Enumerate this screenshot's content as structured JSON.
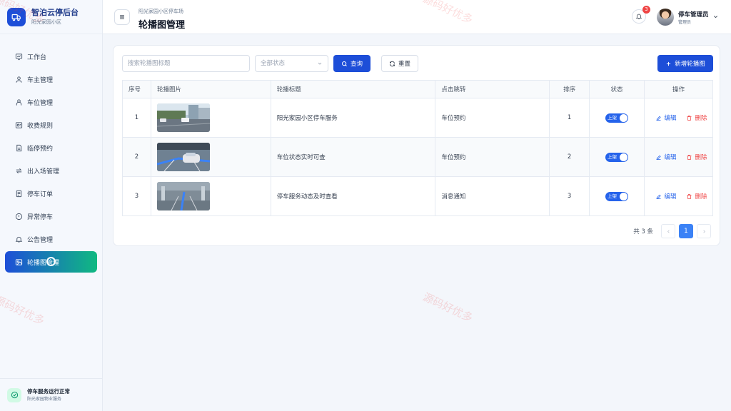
{
  "brand": {
    "title": "智泊云停后台",
    "subtitle": "阳光家园小区"
  },
  "sidebar": {
    "items": [
      {
        "label": "工作台",
        "icon": "dashboard-icon"
      },
      {
        "label": "车主管理",
        "icon": "user-icon"
      },
      {
        "label": "车位管理",
        "icon": "parking-space-icon"
      },
      {
        "label": "收费规则",
        "icon": "fee-rule-icon"
      },
      {
        "label": "临停预约",
        "icon": "reservation-icon"
      },
      {
        "label": "出入场管理",
        "icon": "swap-icon"
      },
      {
        "label": "停车订单",
        "icon": "order-icon"
      },
      {
        "label": "异常停车",
        "icon": "alert-icon"
      },
      {
        "label": "公告管理",
        "icon": "bell-icon"
      },
      {
        "label": "轮播图管理",
        "icon": "image-icon",
        "active": true
      }
    ],
    "footer": {
      "title": "停车服务运行正常",
      "subtitle": "阳光家园物业服务"
    }
  },
  "header": {
    "breadcrumb": "阳光家园小区停车场",
    "title": "轮播图管理",
    "notification_count": "3",
    "user_name": "停车管理员",
    "user_role": "管理员"
  },
  "toolbar": {
    "search_placeholder": "搜索轮播图标题",
    "status_placeholder": "全部状态",
    "query_label": "查询",
    "reset_label": "重置",
    "add_label": "新增轮播图"
  },
  "table": {
    "headers": [
      "序号",
      "轮播图片",
      "轮播标题",
      "点击跳转",
      "排序",
      "状态",
      "操作"
    ],
    "rows": [
      {
        "index": "1",
        "title": "阳光家园小区停车服务",
        "link": "车位预约",
        "sort": "1",
        "status": "上架",
        "image": "parking-lot-photo"
      },
      {
        "index": "2",
        "title": "车位状态实时可查",
        "link": "车位预约",
        "sort": "2",
        "status": "上架",
        "image": "parking-space-photo"
      },
      {
        "index": "3",
        "title": "停车服务动态及时查看",
        "link": "消息通知",
        "sort": "3",
        "status": "上架",
        "image": "underground-garage-photo"
      }
    ],
    "edit_label": "编辑",
    "delete_label": "删除"
  },
  "pagination": {
    "total_text": "共 3 条",
    "current_page": "1"
  },
  "watermark": "源码好优多",
  "colors": {
    "primary": "#1d4ed8",
    "accent": "#10b981",
    "danger": "#ef4444"
  }
}
